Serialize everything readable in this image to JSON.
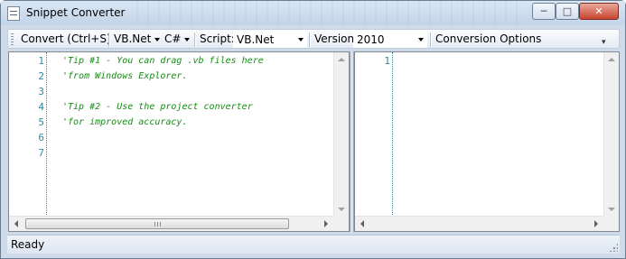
{
  "window": {
    "title": "Snippet Converter",
    "minimize_label": "─",
    "maximize_label": "□",
    "close_label": "✕"
  },
  "toolbar": {
    "convert_label": "Convert (Ctrl+S)",
    "source_language": "VB.Net",
    "target_language": "C#",
    "script_label": "Script:",
    "script_value": "VB.Net",
    "version_label": "Version:",
    "version_value": "2010",
    "options_label": "Conversion Options"
  },
  "left_editor": {
    "line_numbers": [
      "1",
      "2",
      "3",
      "4",
      "5",
      "6",
      "7"
    ],
    "lines": [
      "'Tip #1 - You can drag .vb files here",
      "'from Windows Explorer.",
      "",
      "'Tip #2 - Use the project converter",
      "'for improved accuracy.",
      "",
      ""
    ]
  },
  "right_editor": {
    "line_numbers": [
      "1"
    ],
    "lines": [
      ""
    ]
  },
  "status": {
    "text": "Ready"
  },
  "colors": {
    "comment": "#188a18",
    "line_number": "#2b8aa0",
    "title_bar": "#c3d4e8",
    "close_button": "#c7452f"
  }
}
